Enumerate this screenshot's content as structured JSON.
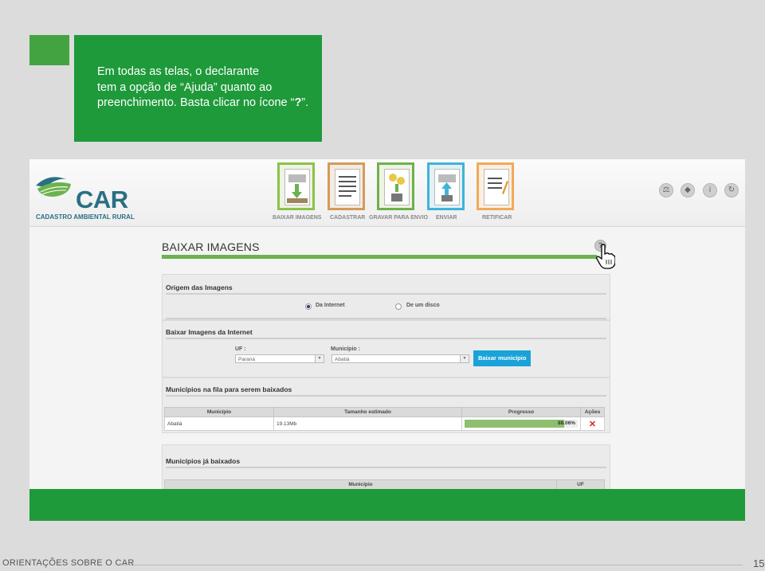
{
  "callout": {
    "line1": "Em todas as telas, o declarante",
    "line2": "tem a opção de “Ajuda” quanto ao",
    "line3_pre": "preenchimento. Basta clicar no ícone “",
    "line3_bold": "?",
    "line3_post": "”."
  },
  "app": {
    "logo_text": "CAR",
    "logo_subtitle": "CADASTRO AMBIENTAL RURAL",
    "steps": [
      {
        "label": "BAIXAR IMAGENS",
        "icon": "download-images-icon"
      },
      {
        "label": "CADASTRAR",
        "icon": "register-form-icon"
      },
      {
        "label": "GRAVAR PARA ENVIO",
        "icon": "save-for-upload-icon"
      },
      {
        "label": "ENVIAR",
        "icon": "send-icon"
      },
      {
        "label": "RETIFICAR",
        "icon": "rectify-icon"
      }
    ],
    "header_icons": [
      "scale-icon",
      "book-icon",
      "info-icon",
      "refresh-icon"
    ]
  },
  "page": {
    "title": "BAIXAR IMAGENS",
    "help_symbol": "?",
    "origin": {
      "title": "Origem das Imagens",
      "option_internet": "Da Internet",
      "option_disk": "De um disco"
    },
    "download": {
      "title": "Baixar Imagens da Internet",
      "uf_label": "UF :",
      "uf_value": "Paraná",
      "municipio_label": "Município :",
      "municipio_value": "Abatiá",
      "button": "Baixar município"
    },
    "queue": {
      "title": "Municípios na fila para serem baixados",
      "headers": [
        "Município",
        "Tamanho estimado",
        "Progresso",
        "Ações"
      ],
      "row": {
        "municipio": "Abatiá",
        "tamanho": "19.13Mb",
        "progresso_text": "88.06%",
        "progresso": 0.8806
      }
    },
    "downloaded": {
      "title": "Municípios já baixados",
      "headers": [
        "Município",
        "UF"
      ]
    }
  },
  "footer": {
    "text": "ORIENTAÇÕES SOBRE O CAR",
    "page_number": "15"
  },
  "colors": {
    "brand_green": "#1e9a3a",
    "bar_green": "#6cb24d",
    "button_blue": "#1aa3d8"
  }
}
